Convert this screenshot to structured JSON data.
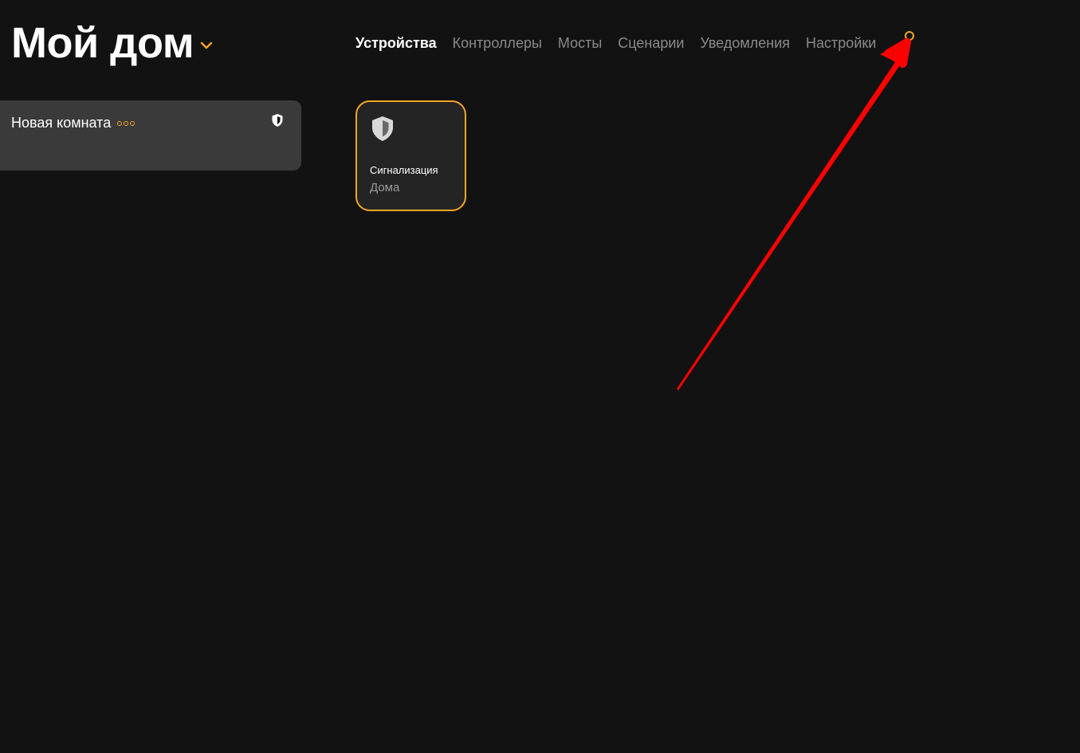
{
  "header": {
    "home_title": "Мой дом"
  },
  "nav": {
    "tabs": [
      {
        "label": "Устройства",
        "active": true
      },
      {
        "label": "Контроллеры",
        "active": false
      },
      {
        "label": "Мосты",
        "active": false
      },
      {
        "label": "Сценарии",
        "active": false
      },
      {
        "label": "Уведомления",
        "active": false
      },
      {
        "label": "Настройки",
        "active": false
      }
    ]
  },
  "rooms": [
    {
      "name": "Новая комната",
      "icon": "shield-icon"
    }
  ],
  "devices": [
    {
      "name": "Сигнализация",
      "room": "Дома",
      "icon": "shield-icon"
    }
  ],
  "colors": {
    "background": "#121212",
    "accent": "#f5a623",
    "card": "#3a3a3a",
    "device_card": "#242424",
    "annotation": "#ff0000"
  }
}
